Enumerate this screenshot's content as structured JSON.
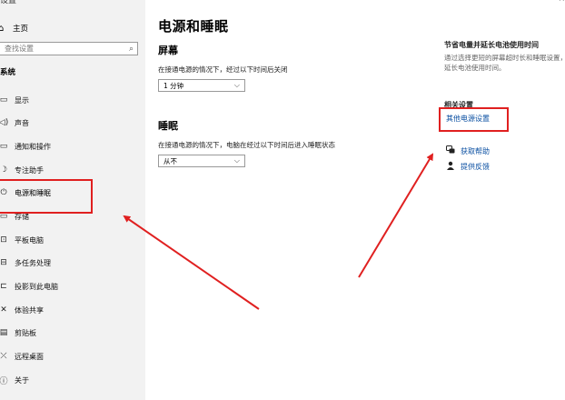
{
  "window": {
    "title": "设置",
    "controls": "–  ×"
  },
  "sidebar": {
    "home": {
      "icon": "home-icon",
      "glyph": "⌂",
      "label": "主页"
    },
    "search": {
      "placeholder": "查找设置",
      "icon": "search-icon",
      "glyph": "⌕"
    },
    "section": "系统",
    "items": [
      {
        "label": "显示",
        "icon": "display-icon",
        "glyph": "▭"
      },
      {
        "label": "声音",
        "icon": "sound-icon",
        "glyph": "◁)"
      },
      {
        "label": "通知和操作",
        "icon": "notification-icon",
        "glyph": "▭"
      },
      {
        "label": "专注助手",
        "icon": "focus-assist-icon",
        "glyph": "☽"
      },
      {
        "label": "电源和睡眠",
        "icon": "power-icon",
        "glyph": "⏻"
      },
      {
        "label": "存储",
        "icon": "storage-icon",
        "glyph": "▭"
      },
      {
        "label": "平板电脑",
        "icon": "tablet-icon",
        "glyph": "⊡"
      },
      {
        "label": "多任务处理",
        "icon": "multitasking-icon",
        "glyph": "⊟"
      },
      {
        "label": "投影到此电脑",
        "icon": "projection-icon",
        "glyph": "⊏"
      },
      {
        "label": "体验共享",
        "icon": "shared-experience-icon",
        "glyph": "✕"
      },
      {
        "label": "剪贴板",
        "icon": "clipboard-icon",
        "glyph": "▤"
      },
      {
        "label": "远程桌面",
        "icon": "remote-desktop-icon",
        "glyph": "⤫"
      },
      {
        "label": "关于",
        "icon": "about-icon",
        "glyph": "ⓘ"
      }
    ]
  },
  "main": {
    "title": "电源和睡眠",
    "screen": {
      "heading": "屏幕",
      "description": "在接通电源的情况下，经过以下时间后关闭",
      "value": "1 分钟"
    },
    "sleep": {
      "heading": "睡眠",
      "description": "在接通电源的情况下，电脑在经过以下时间后进入睡眠状态",
      "value": "从不"
    }
  },
  "right": {
    "tip_title": "节省电量并延长电池使用时间",
    "tip_desc": "通过选择更短的屏幕超时长和睡眠设置，延长电池使用时间。",
    "related_title": "相关设置",
    "related_link": "其他电源设置",
    "help": {
      "label": "获取帮助",
      "icon": "help-icon",
      "glyph": "💬"
    },
    "feedback": {
      "label": "提供反馈",
      "icon": "feedback-icon",
      "glyph": "👤"
    }
  },
  "annotations": {
    "highlight_color": "#e02020"
  }
}
